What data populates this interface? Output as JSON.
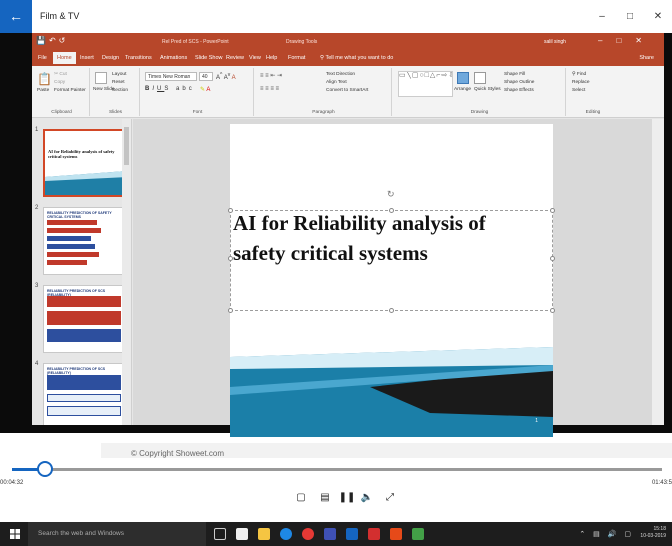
{
  "window": {
    "title": "Film & TV",
    "back_icon": "arrow-left-icon",
    "minimize": "–",
    "maximize": "□",
    "close": "✕"
  },
  "ppt": {
    "doc_title": "Rel Pred of SCS - PowerPoint",
    "tools_label": "Drawing Tools",
    "user": "salil singh",
    "tabs": [
      "File",
      "Home",
      "Insert",
      "Design",
      "Transitions",
      "Animations",
      "Slide Show",
      "Review",
      "View",
      "Help",
      "Format"
    ],
    "tell_me": "Tell me what you want to do",
    "share": "Share",
    "ribbon": {
      "clipboard": {
        "label": "Clipboard",
        "paste": "Paste",
        "cut": "Cut",
        "copy": "Copy",
        "format_painter": "Format Painter"
      },
      "slides": {
        "label": "Slides",
        "new_slide": "New Slide",
        "layout": "Layout",
        "reset": "Reset",
        "section": "Section"
      },
      "font": {
        "label": "Font",
        "family": "Times New Roman",
        "size": "40"
      },
      "paragraph": {
        "label": "Paragraph",
        "text_direction": "Text Direction",
        "align_text": "Align Text",
        "smartart": "Convert to SmartArt"
      },
      "drawing": {
        "label": "Drawing",
        "arrange": "Arrange",
        "quick_styles": "Quick Styles",
        "shape_fill": "Shape Fill",
        "shape_outline": "Shape Outline",
        "shape_effects": "Shape Effects"
      },
      "editing": {
        "label": "Editing",
        "find": "Find",
        "replace": "Replace",
        "select": "Select"
      }
    },
    "thumbnails": [
      {
        "num": "1",
        "title": "AI for Reliability analysis of safety critical systems"
      },
      {
        "num": "2",
        "title": "RELIABILITY PREDICTION OF SAFETY CRITICAL SYSTEMS"
      },
      {
        "num": "3",
        "title": "RELIABILITY PREDICTION OF SCS (RELIABILITY)"
      },
      {
        "num": "4",
        "title": "RELIABILITY PREDICTION OF SCS (RELIABILITY)"
      },
      {
        "num": "5",
        "title": ""
      }
    ],
    "slide": {
      "title_line1": "AI for Reliability analysis of",
      "title_line2": "safety critical systems",
      "number": "1"
    }
  },
  "watermark": "© Copyright Showeet.com",
  "player": {
    "elapsed": "00:04:32",
    "total": "01:43:5",
    "progress_percent": 5
  },
  "taskbar": {
    "search_placeholder": "Search the web and Windows",
    "time": "15:18",
    "date": "10-03-2019"
  }
}
